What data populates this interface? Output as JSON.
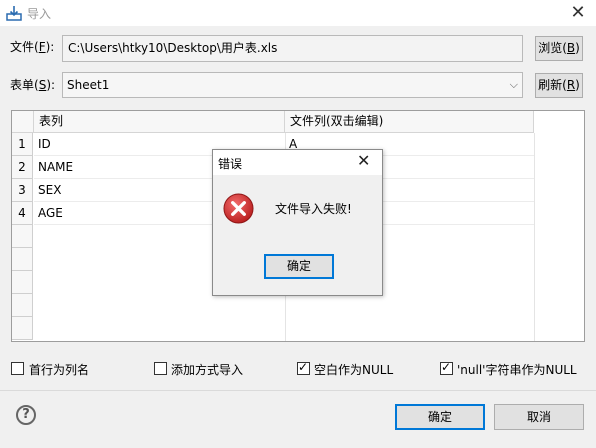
{
  "window": {
    "title": "导入",
    "app_icon": "import-icon",
    "close_glyph": "✕"
  },
  "file_row": {
    "label_prefix": "文件(",
    "label_key": "F",
    "label_suffix": "):",
    "value": "C:\\Users\\htky10\\Desktop\\用户表.xls",
    "browse_prefix": "浏览(",
    "browse_key": "B",
    "browse_suffix": ")"
  },
  "sheet_row": {
    "label_prefix": "表单(",
    "label_key": "S",
    "label_suffix": "):",
    "selected": "Sheet1",
    "refresh_prefix": "刷新(",
    "refresh_key": "R",
    "refresh_suffix": ")"
  },
  "grid": {
    "headers": [
      "表列",
      "文件列(双击编辑)"
    ],
    "rows": [
      {
        "num": "1",
        "col": "ID",
        "file_col": "A"
      },
      {
        "num": "2",
        "col": "NAME",
        "file_col": ""
      },
      {
        "num": "3",
        "col": "SEX",
        "file_col": ""
      },
      {
        "num": "4",
        "col": "AGE",
        "file_col": ""
      }
    ]
  },
  "options": [
    {
      "label": "首行为列名",
      "checked": false
    },
    {
      "label": "添加方式导入",
      "checked": false
    },
    {
      "label": "空白作为NULL",
      "checked": true
    },
    {
      "label": "'null'字符串作为NULL",
      "checked": true
    }
  ],
  "footer": {
    "help_glyph": "?",
    "ok_label": "确定",
    "cancel_label": "取消"
  },
  "error_dialog": {
    "title": "错误",
    "close_glyph": "✕",
    "message": "文件导入失败!",
    "ok_label": "确定",
    "icon": "error-icon",
    "icon_color": "#d9272e"
  }
}
